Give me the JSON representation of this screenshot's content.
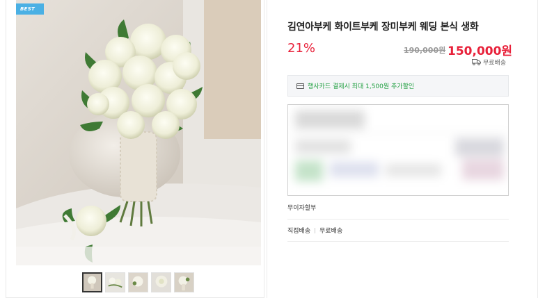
{
  "badge": {
    "label": "BEST"
  },
  "gallery": {
    "main_image": "white-rose-tulip-bridal-bouquet",
    "thumbnails": [
      "bouquet-main",
      "bouquet-spread",
      "bouquet-detail",
      "bouquet-closeup",
      "bouquet-side"
    ],
    "active_index": 0
  },
  "product": {
    "title": "김연아부케 화이트부케 장미부케 웨딩 본식 생화",
    "discount_rate": "21%",
    "original_price": "190,000원",
    "sale_price": "150,000원",
    "shipping_label": "무료배송"
  },
  "promo": {
    "text": "행사카드 결제시 최대 1,500원 추가할인"
  },
  "payment": {
    "interest_free": "무이자할부"
  },
  "delivery": {
    "method": "직접배송",
    "fee": "무료배송"
  },
  "colors": {
    "accent_red": "#e8213a",
    "promo_green": "#1d9e3e",
    "badge_blue": "#4ab0e4"
  }
}
